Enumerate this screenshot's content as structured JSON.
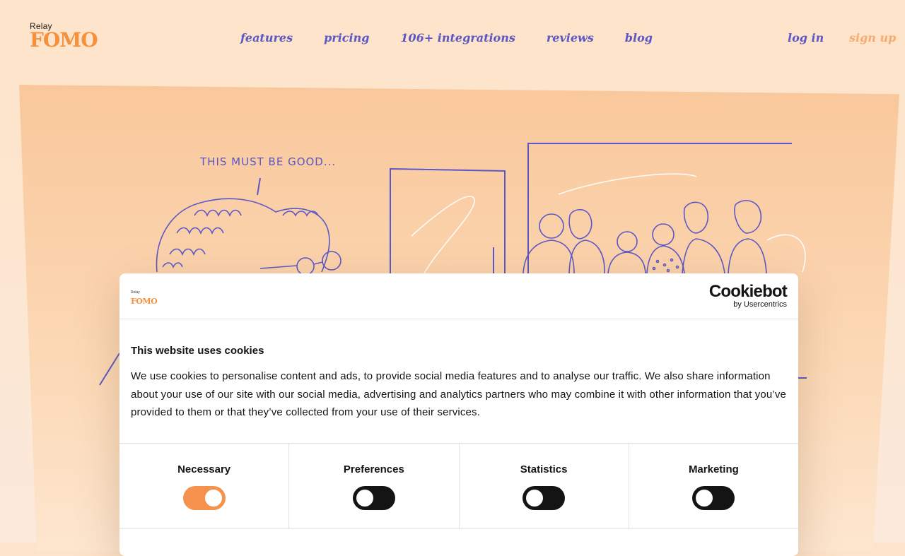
{
  "header": {
    "logo_small": "Relay",
    "logo_big": "FOMO",
    "nav": [
      "features",
      "pricing",
      "106+ integrations",
      "reviews",
      "blog"
    ],
    "login": "log in",
    "signup": "sign up"
  },
  "hero": {
    "speech_text": "THIS MUST BE GOOD..."
  },
  "cookie_banner": {
    "mini_logo_small": "Relay",
    "mini_logo_big": "FOMO",
    "brand_name": "Cookiebot",
    "brand_by": "by Usercentrics",
    "title": "This website uses cookies",
    "text": "We use cookies to personalise content and ads, to provide social media features and to analyse our traffic. We also share information about your use of our site with our social media, advertising and analytics partners who may combine it with other information that you’ve provided to them or that they’ve collected from your use of their services.",
    "toggles": [
      {
        "label": "Necessary",
        "state": "on"
      },
      {
        "label": "Preferences",
        "state": "off"
      },
      {
        "label": "Statistics",
        "state": "off"
      },
      {
        "label": "Marketing",
        "state": "off"
      }
    ]
  },
  "colors": {
    "accent_orange": "#f5913b",
    "nav_purple": "#5b57c7",
    "toggle_on": "#f5924d",
    "toggle_off": "#141414"
  }
}
